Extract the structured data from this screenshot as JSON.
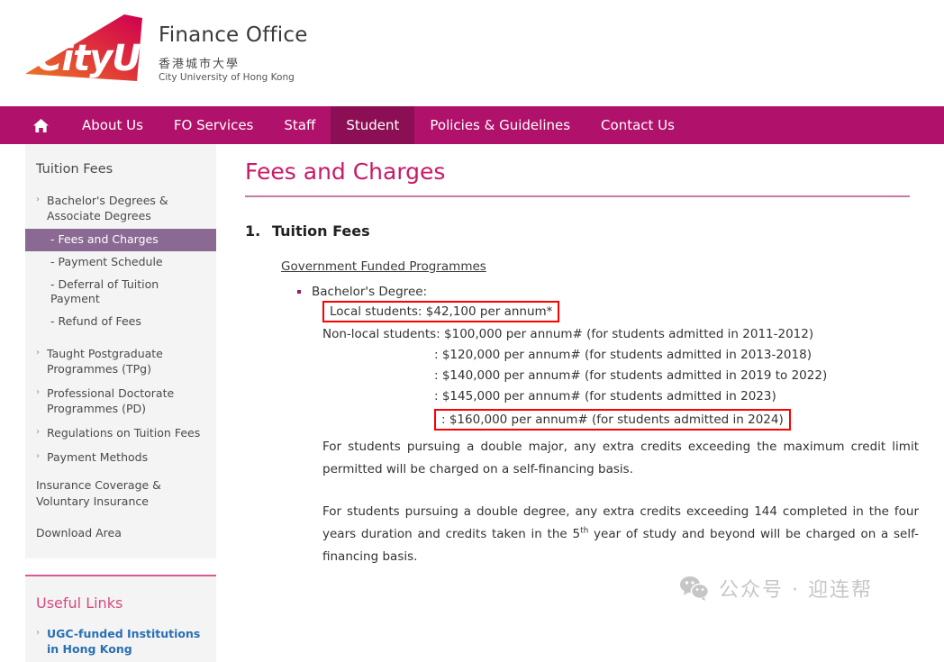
{
  "header": {
    "logo_text": "CityU",
    "office_name": "Finance Office",
    "university_zh": "香港城市大學",
    "university_en": "City University of Hong Kong",
    "logo_gradient_from": "#e8722a",
    "logo_gradient_to": "#d4073f"
  },
  "nav": {
    "background": "#b0116a",
    "active_background": "#8c0e55",
    "home_icon": "home-icon",
    "items": [
      {
        "label": "About Us",
        "active": false
      },
      {
        "label": "FO Services",
        "active": false
      },
      {
        "label": "Staff",
        "active": false
      },
      {
        "label": "Student",
        "active": true
      },
      {
        "label": "Policies & Guidelines",
        "active": false
      },
      {
        "label": "Contact Us",
        "active": false
      }
    ]
  },
  "sidebar": {
    "heading": "Tuition Fees",
    "active_background": "#8a6a93",
    "items": [
      {
        "label": "Bachelor's Degrees & Associate Degrees",
        "type": "arrow"
      },
      {
        "label": "- Fees and Charges",
        "type": "sub",
        "active": true
      },
      {
        "label": "- Payment Schedule",
        "type": "sub",
        "active": false
      },
      {
        "label": "- Deferral of Tuition Payment",
        "type": "sub",
        "active": false
      },
      {
        "label": "- Refund of Fees",
        "type": "sub",
        "active": false
      },
      {
        "label": "Taught Postgraduate Programmes (TPg)",
        "type": "arrow"
      },
      {
        "label": "Professional Doctorate Programmes (PD)",
        "type": "arrow"
      },
      {
        "label": "Regulations on Tuition Fees",
        "type": "arrow"
      },
      {
        "label": "Payment Methods",
        "type": "arrow"
      }
    ],
    "plain_items": [
      {
        "label": "Insurance Coverage & Voluntary Insurance"
      },
      {
        "label": "Download Area"
      }
    ],
    "useful_links": {
      "heading": "Useful Links",
      "accent_color": "#d8497f",
      "link_color": "#2a6fb5",
      "items": [
        {
          "label": "UGC-funded Institutions in Hong Kong"
        }
      ]
    }
  },
  "main": {
    "page_title": "Fees and Charges",
    "title_color": "#c91a67",
    "section_number": "1.",
    "section_title": "Tuition Fees",
    "programme_heading": "Government Funded Programmes",
    "degree_label": "Bachelor's Degree:",
    "highlight_color": "#ff0000",
    "fee_lines": [
      {
        "text": "Local students: $42,100 per annum*",
        "boxed": true,
        "indent": false
      },
      {
        "text": "Non-local students: $100,000 per annum# (for students admitted in 2011-2012)",
        "boxed": false,
        "indent": false
      },
      {
        "text": ": $120,000 per annum# (for students admitted in 2013-2018)",
        "boxed": false,
        "indent": true
      },
      {
        "text": ": $140,000 per annum# (for students admitted in 2019 to 2022)",
        "boxed": false,
        "indent": true
      },
      {
        "text": ": $145,000 per annum# (for students admitted in 2023)",
        "boxed": false,
        "indent": true
      },
      {
        "text": ": $160,000 per annum# (for students admitted in 2024)",
        "boxed": true,
        "indent": true
      }
    ],
    "paragraph_1": "For students pursuing a double major, any extra credits exceeding the maximum credit limit permitted will be charged on a self-financing basis.",
    "paragraph_2_part1": "For students pursuing a double degree, any extra credits exceeding 144 completed in the four years duration and credits taken in the 5",
    "paragraph_2_sup": "th",
    "paragraph_2_part2": " year of study and beyond will be charged on a self-financing basis."
  },
  "watermark": {
    "icon": "wechat-icon",
    "text": "公众号 · 迎连帮"
  }
}
